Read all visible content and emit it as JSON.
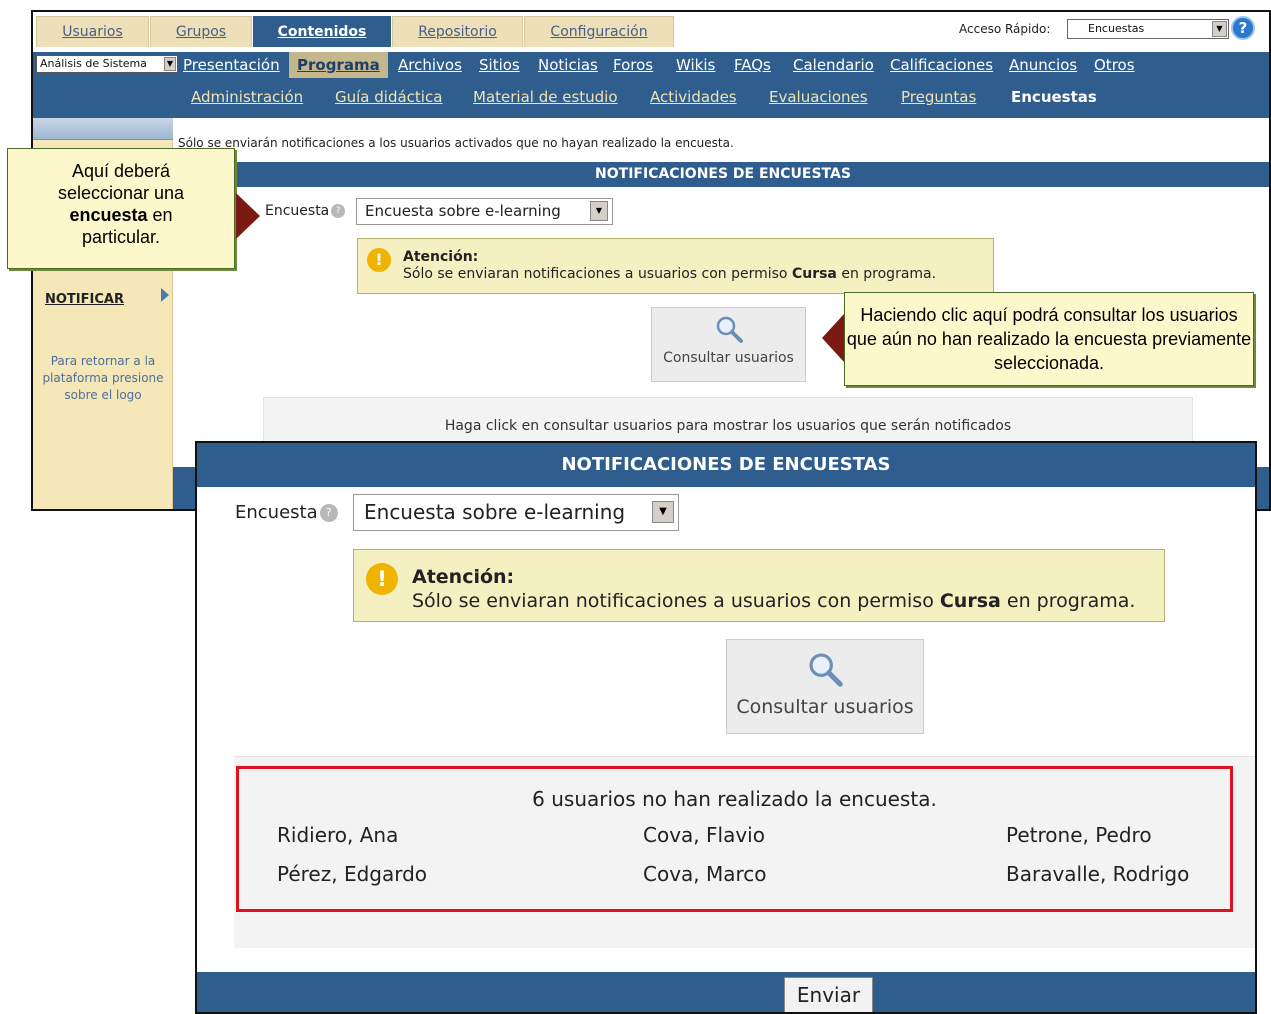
{
  "top_tabs": [
    "Usuarios",
    "Grupos",
    "Contenidos",
    "Repositorio",
    "Configuración"
  ],
  "quick_access": {
    "label": "Acceso Rápido:",
    "value": "Encuestas",
    "help": "?"
  },
  "program_select": "Análisis de Sistema",
  "nav1": [
    "Presentación",
    "Programa",
    "Archivos",
    "Sitios",
    "Noticias",
    "Foros",
    "Wikis",
    "FAQs",
    "Calendario",
    "Calificaciones",
    "Anuncios",
    "Otros"
  ],
  "nav2": [
    "Administración",
    "Guía didáctica",
    "Material de estudio",
    "Actividades",
    "Evaluaciones",
    "Preguntas",
    "Encuestas"
  ],
  "sidebar": {
    "notificar": "NOTIFICAR",
    "note": "Para retornar a la plataforma presione sobre el logo"
  },
  "notice": "Sólo se enviarán notificaciones a los usuarios activados que no hayan realizado la encuesta.",
  "header": "NOTIFICACIONES DE ENCUESTAS",
  "encuesta_label": "Encuesta",
  "encuesta_value": "Encuesta sobre e-learning",
  "attention": {
    "title": "Atención:",
    "text_before": "Sólo se enviaran notificaciones a usuarios con permiso ",
    "bold": "Cursa",
    "text_after": " en programa."
  },
  "consultar_label": "Consultar usuarios",
  "info_text": "Haga click en consultar usuarios para mostrar los usuarios que serán notificados",
  "callout_left": {
    "line1": "Aquí deberá",
    "line2": "seleccionar una",
    "bold": "encuesta",
    "after_bold": " en",
    "line4": "particular."
  },
  "callout_right": "Haciendo clic aquí podrá consultar los usuarios que aún no han realizado la encuesta previamente seleccionada.",
  "users_count_text": "6 usuarios no han realizado la encuesta.",
  "users": [
    "Ridiero, Ana",
    "Cova, Flavio",
    "Petrone, Pedro",
    "Pérez, Edgardo",
    "Cova, Marco",
    "Baravalle, Rodrigo"
  ],
  "enviar_label": "Enviar",
  "colors": {
    "nav_blue": "#2e5d8e",
    "tab_beige": "#ede0b8",
    "attention_bg": "#f5f0c2",
    "red_highlight": "#e0101d",
    "arrow": "#7b1a12"
  }
}
